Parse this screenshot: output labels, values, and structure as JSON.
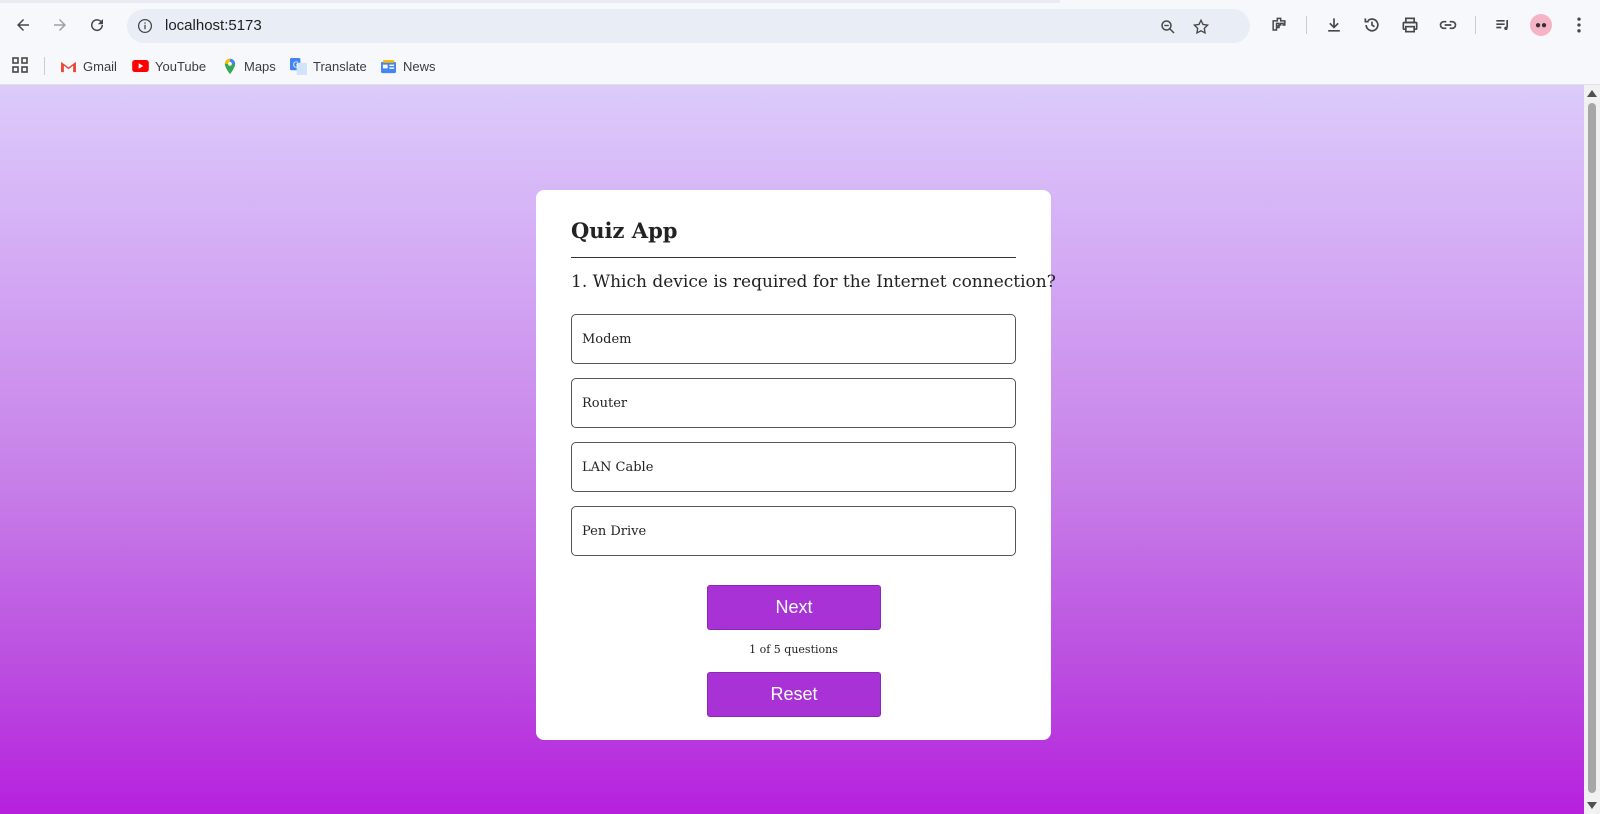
{
  "browser": {
    "url": "localhost:5173",
    "bookmarks": [
      {
        "label": "Gmail",
        "icon": "gmail-icon"
      },
      {
        "label": "YouTube",
        "icon": "youtube-icon"
      },
      {
        "label": "Maps",
        "icon": "maps-icon"
      },
      {
        "label": "Translate",
        "icon": "translate-icon"
      },
      {
        "label": "News",
        "icon": "news-icon"
      }
    ]
  },
  "quiz": {
    "title": "Quiz App",
    "question": "1. Which device is required for the Internet connection?",
    "options": [
      "Modem",
      "Router",
      "LAN Cable",
      "Pen Drive"
    ],
    "next_label": "Next",
    "progress": "1 of 5 questions",
    "reset_label": "Reset"
  },
  "colors": {
    "button": "#a832d6",
    "gradient_top": "#dccbfb",
    "gradient_bottom": "#b620dd"
  }
}
